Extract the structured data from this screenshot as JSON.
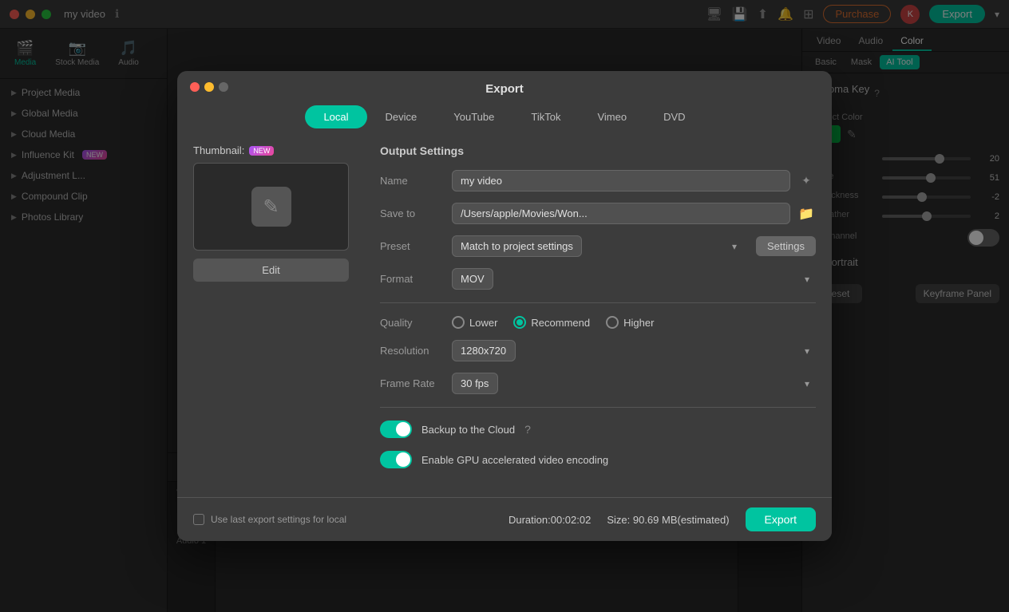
{
  "app": {
    "title": "my video",
    "traffic_lights": [
      "red",
      "yellow",
      "green"
    ]
  },
  "topbar": {
    "purchase_label": "Purchase",
    "export_label": "Export",
    "avatar_initials": "K"
  },
  "sidebar": {
    "tabs": [
      {
        "id": "media",
        "label": "Media",
        "icon": "🎬"
      },
      {
        "id": "stock",
        "label": "Stock Media",
        "icon": "📷"
      },
      {
        "id": "audio",
        "label": "Audio",
        "icon": "🎵"
      }
    ],
    "items": [
      {
        "label": "Project Media",
        "has_badge": false,
        "badge_text": ""
      },
      {
        "label": "Global Media",
        "has_badge": false,
        "badge_text": ""
      },
      {
        "label": "Cloud Media",
        "has_badge": false,
        "badge_text": ""
      },
      {
        "label": "Influence Kit",
        "has_badge": true,
        "badge_text": "NEW"
      },
      {
        "label": "Adjustment L...",
        "has_badge": false,
        "badge_text": ""
      },
      {
        "label": "Compound Clip",
        "has_badge": false,
        "badge_text": ""
      },
      {
        "label": "Photos Library",
        "has_badge": false,
        "badge_text": ""
      }
    ]
  },
  "right_panel": {
    "tabs": [
      "Video",
      "Audio",
      "Color"
    ],
    "active_tab": "Color",
    "subtabs": [
      "Basic",
      "Mask",
      "AI Tool"
    ],
    "active_subtab": "AI Tool",
    "section_title": "Chroma Key",
    "project_color_label": "Project Color",
    "sliders": [
      {
        "label": "set",
        "value": 20,
        "fill_pct": 65
      },
      {
        "label": "rance",
        "value": 51,
        "fill_pct": 55
      },
      {
        "label": "e Thickness",
        "value": -2.0,
        "fill_pct": 45
      },
      {
        "label": "e Feather",
        "value": 2.0,
        "fill_pct": 50
      }
    ],
    "alpha_channel_label": "na Channel",
    "ai_portrait_label": "AI Portrait",
    "reset_label": "Reset",
    "keyframe_label": "Keyframe Panel"
  },
  "export_modal": {
    "title": "Export",
    "tabs": [
      "Local",
      "Device",
      "YouTube",
      "TikTok",
      "Vimeo",
      "DVD"
    ],
    "active_tab": "Local",
    "thumbnail_label": "Thumbnail:",
    "thumbnail_badge": "NEW",
    "edit_btn": "Edit",
    "output_title": "Output Settings",
    "fields": {
      "name_label": "Name",
      "name_value": "my video",
      "save_to_label": "Save to",
      "save_to_value": "/Users/apple/Movies/Won...",
      "preset_label": "Preset",
      "preset_value": "Match to project settings",
      "settings_btn": "Settings",
      "format_label": "Format",
      "format_value": "MOV"
    },
    "quality": {
      "label": "Quality",
      "options": [
        "Lower",
        "Recommend",
        "Higher"
      ],
      "selected": "Recommend"
    },
    "resolution": {
      "label": "Resolution",
      "value": "1280x720"
    },
    "frame_rate": {
      "label": "Frame Rate",
      "value": "30 fps"
    },
    "backup_label": "Backup to the Cloud",
    "gpu_label": "Enable GPU accelerated video encoding",
    "footer": {
      "checkbox_label": "Use last export settings for local",
      "duration_label": "Duration:00:02:02",
      "size_label": "Size: 90.69 MB(estimated)",
      "export_btn": "Export"
    }
  }
}
